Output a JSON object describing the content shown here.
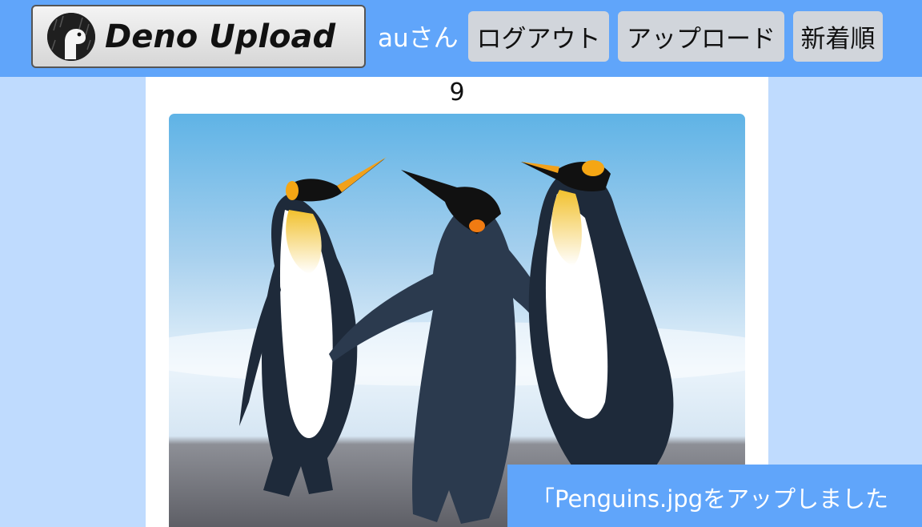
{
  "header": {
    "logo_text": "Deno Upload",
    "logo_icon": "deno-dinosaur-icon",
    "username": "auさん",
    "logout_label": "ログアウト",
    "upload_label": "アップロード",
    "sort_label": "新着順"
  },
  "main": {
    "count": "9",
    "photo_subject": "penguins-photo"
  },
  "toast": {
    "message": "「Penguins.jpgをアップしました"
  },
  "colors": {
    "header_bg": "#60a5fa",
    "page_bg": "#bfdbfe",
    "button_bg": "#d1d5db",
    "toast_bg": "#60a5fa"
  }
}
